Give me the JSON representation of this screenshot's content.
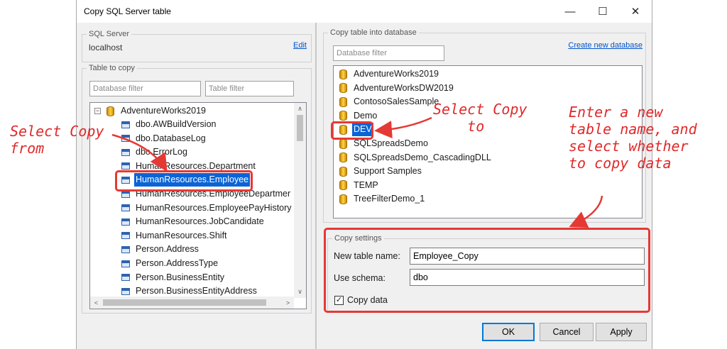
{
  "window": {
    "title": "Copy SQL Server table",
    "minimize_glyph": "—",
    "maximize_glyph": "☐",
    "close_glyph": "✕"
  },
  "sql_server": {
    "label": "SQL Server",
    "value": "localhost",
    "edit_label": "Edit"
  },
  "table_to_copy": {
    "label": "Table to copy",
    "db_filter_placeholder": "Database filter",
    "table_filter_placeholder": "Table filter",
    "root": {
      "expander": "−",
      "name": "AdventureWorks2019"
    },
    "tables": [
      "dbo.AWBuildVersion",
      "dbo.DatabaseLog",
      "dbo.ErrorLog",
      "HumanResources.Department",
      "HumanResources.Employee",
      "HumanResources.EmployeeDepartmer",
      "HumanResources.EmployeePayHistory",
      "HumanResources.JobCandidate",
      "HumanResources.Shift",
      "Person.Address",
      "Person.AddressType",
      "Person.BusinessEntity",
      "Person.BusinessEntityAddress"
    ],
    "selected_table": "HumanResources.Employee",
    "scroll_up": "∧",
    "scroll_down": "∨",
    "scroll_left": "<",
    "scroll_right": ">"
  },
  "copy_into": {
    "label": "Copy table into database",
    "db_filter_placeholder": "Database filter",
    "create_link": "Create new database",
    "databases": [
      "AdventureWorks2019",
      "AdventureWorksDW2019",
      "ContosoSalesSample",
      "Demo",
      "DEV",
      "SQLSpreadsDemo",
      "SQLSpreadsDemo_CascadingDLL",
      "Support Samples",
      "TEMP",
      "TreeFilterDemo_1"
    ],
    "selected_database": "DEV"
  },
  "copy_settings": {
    "label": "Copy settings",
    "new_table_label": "New table name:",
    "new_table_value": "Employee_Copy",
    "schema_label": "Use schema:",
    "schema_value": "dbo",
    "copy_data_label": "Copy data",
    "copy_data_checked": true,
    "check_glyph": "✓"
  },
  "buttons": {
    "ok": "OK",
    "cancel": "Cancel",
    "apply": "Apply"
  },
  "annotations": {
    "copy_from": "Select Copy\nfrom",
    "copy_to": "Select Copy\n    to",
    "new_table": "Enter a new\ntable name, and\nselect whether\nto copy data",
    "color": "#e53935"
  }
}
